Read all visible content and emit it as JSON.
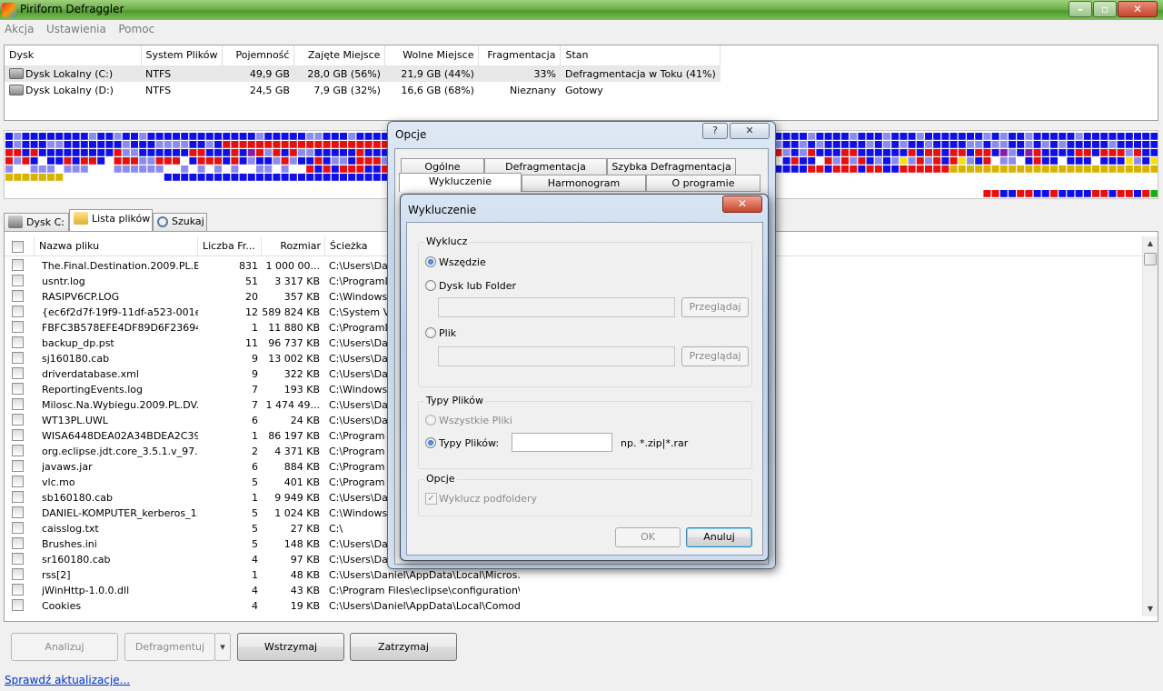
{
  "window": {
    "title": "Piriform Defraggler"
  },
  "menu": [
    "Akcja",
    "Ustawienia",
    "Pomoc"
  ],
  "drives": {
    "columns": [
      "Dysk",
      "System Plików",
      "Pojemność",
      "Zajęte Miejsce",
      "Wolne Miejsce",
      "Fragmentacja",
      "Stan"
    ],
    "rows": [
      [
        "Dysk Lokalny (C:)",
        "NTFS",
        "49,9 GB",
        "28,0 GB (56%)",
        "21,9 GB (44%)",
        "33%",
        "Defragmentacja w Toku (41%)"
      ],
      [
        "Dysk Lokalny (D:)",
        "NTFS",
        "24,5 GB",
        "7,9 GB (32%)",
        "16,6 GB (68%)",
        "Nieznany",
        "Gotowy"
      ]
    ]
  },
  "colors": {
    "blue": "#1010e6",
    "red": "#e61010",
    "light_blue": "#8c8cf0",
    "yellow": "#f5e014",
    "gold": "#d8b400",
    "purple": "#8a1aa8",
    "green": "#18b018",
    "white": "#ffffff"
  },
  "tabs": [
    "Dysk C:",
    "Lista plików",
    "Szukaj"
  ],
  "files": {
    "columns": [
      "Nazwa pliku",
      "Liczba Fr...",
      "Rozmiar",
      "Ścieżka"
    ],
    "rows": [
      [
        "The.Final.Destination.2009.PL.B...",
        "831",
        "1 000 00...",
        "C:\\Users\\Dani"
      ],
      [
        "usntr.log",
        "51",
        "3 317 KB",
        "C:\\ProgramDa"
      ],
      [
        "RASIPV6CP.LOG",
        "20",
        "357 KB",
        "C:\\Windows\\"
      ],
      [
        "{ec6f2d7f-19f9-11df-a523-001e...",
        "12",
        "589 824 KB",
        "C:\\System Vo"
      ],
      [
        "FBFC3B578EFE4DF89D6F23694...",
        "1",
        "11 880 KB",
        "C:\\ProgramDa"
      ],
      [
        "backup_dp.pst",
        "11",
        "96 737 KB",
        "C:\\Users\\Dani"
      ],
      [
        "sj160180.cab",
        "9",
        "13 002 KB",
        "C:\\Users\\Dani"
      ],
      [
        "driverdatabase.xml",
        "9",
        "322 KB",
        "C:\\Users\\Dani"
      ],
      [
        "ReportingEvents.log",
        "7",
        "193 KB",
        "C:\\Windows\\"
      ],
      [
        "Milosc.Na.Wybiegu.2009.PL.DV...",
        "7",
        "1 474 49...",
        "C:\\Users\\Dani"
      ],
      [
        "WT13PL.UWL",
        "6",
        "24 KB",
        "C:\\Users\\Dani"
      ],
      [
        "WISA6448DEA02A34BDEA2C39...",
        "1",
        "86 197 KB",
        "C:\\Program Fi"
      ],
      [
        "org.eclipse.jdt.core_3.5.1.v_97...",
        "2",
        "4 371 KB",
        "C:\\Program Fi"
      ],
      [
        "javaws.jar",
        "6",
        "884 KB",
        "C:\\Program Fi"
      ],
      [
        "vlc.mo",
        "5",
        "401 KB",
        "C:\\Program Fi"
      ],
      [
        "sb160180.cab",
        "1",
        "9 949 KB",
        "C:\\Users\\Dani"
      ],
      [
        "DANIEL-KOMPUTER_kerberos_1...",
        "5",
        "1 024 KB",
        "C:\\Windows\\"
      ],
      [
        "caisslog.txt",
        "5",
        "27 KB",
        "C:\\"
      ],
      [
        "Brushes.ini",
        "5",
        "148 KB",
        "C:\\Users\\Dani"
      ],
      [
        "sr160180.cab",
        "4",
        "97 KB",
        "C:\\Users\\Dani"
      ],
      [
        "rss[2]",
        "1",
        "48 KB",
        "C:\\Users\\Daniel\\AppData\\Local\\Micros..."
      ],
      [
        "jWinHttp-1.0.0.dll",
        "4",
        "43 KB",
        "C:\\Program Files\\eclipse\\configuration\\..."
      ],
      [
        "Cookies",
        "4",
        "19 KB",
        "C:\\Users\\Daniel\\AppData\\Local\\Comod..."
      ]
    ]
  },
  "buttons": {
    "analyze": "Analizuj",
    "defrag": "Defragmentuj",
    "pause": "Wstrzymaj",
    "stop": "Zatrzymaj"
  },
  "status": {
    "update_link": "Sprawdź aktualizacje..."
  },
  "options_dialog": {
    "title": "Opcje",
    "help": "?",
    "tabs_row1": [
      "Ogólne",
      "Defragmentacja",
      "Szybka Defragmentacja"
    ],
    "tabs_row2": [
      "Wykluczenie",
      "Harmonogram",
      "O programie"
    ]
  },
  "exclude_dialog": {
    "title": "Wykluczenie",
    "group_exclude": "Wyklucz",
    "everywhere": "Wszędzie",
    "disk_or_folder": "Dysk lub Folder",
    "browse": "Przeglądaj",
    "file": "Plik",
    "group_types": "Typy Plików",
    "all_files": "Wszystkie Pliki",
    "file_types": "Typy Plików:",
    "file_types_hint": "np. *.zip|*.rar",
    "group_options": "Opcje",
    "exclude_subfolders": "Wyklucz podfoldery",
    "ok": "OK",
    "cancel": "Anuluj"
  }
}
